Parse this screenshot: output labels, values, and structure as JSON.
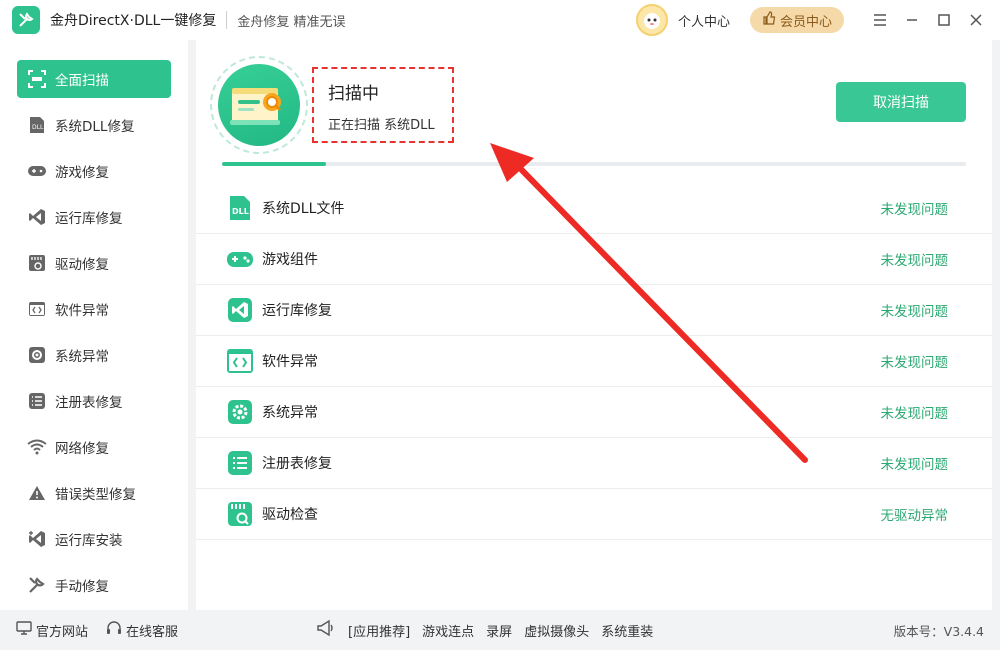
{
  "titlebar": {
    "app_title": "金舟DirectX·DLL一键修复",
    "slogan": "金舟修复 精准无误",
    "personal_center": "个人中心",
    "vip_center": "会员中心"
  },
  "sidebar": {
    "items": [
      {
        "label": "全面扫描",
        "icon": "full-scan-icon"
      },
      {
        "label": "系统DLL修复",
        "icon": "dll-icon"
      },
      {
        "label": "游戏修复",
        "icon": "gamepad-icon"
      },
      {
        "label": "运行库修复",
        "icon": "runtime-icon"
      },
      {
        "label": "驱动修复",
        "icon": "driver-icon"
      },
      {
        "label": "软件异常",
        "icon": "code-window-icon"
      },
      {
        "label": "系统异常",
        "icon": "gear-icon"
      },
      {
        "label": "注册表修复",
        "icon": "list-icon"
      },
      {
        "label": "网络修复",
        "icon": "wifi-icon"
      },
      {
        "label": "错误类型修复",
        "icon": "warning-icon"
      },
      {
        "label": "运行库安装",
        "icon": "install-icon"
      },
      {
        "label": "手动修复",
        "icon": "wrench-icon"
      }
    ]
  },
  "scan": {
    "title": "扫描中",
    "subtitle": "正在扫描 系统DLL",
    "cancel_label": "取消扫描",
    "progress_percent": 14
  },
  "results": [
    {
      "label": "系统DLL文件",
      "status": "未发现问题"
    },
    {
      "label": "游戏组件",
      "status": "未发现问题"
    },
    {
      "label": "运行库修复",
      "status": "未发现问题"
    },
    {
      "label": "软件异常",
      "status": "未发现问题"
    },
    {
      "label": "系统异常",
      "status": "未发现问题"
    },
    {
      "label": "注册表修复",
      "status": "未发现问题"
    },
    {
      "label": "驱动检查",
      "status": "无驱动异常"
    }
  ],
  "footer": {
    "official_site": "官方网站",
    "online_service": "在线客服",
    "app_recommend": "[应用推荐]",
    "links": [
      "游戏连点",
      "录屏",
      "虚拟摄像头",
      "系统重装"
    ],
    "version": "版本号：V3.4.4"
  },
  "colors": {
    "accent": "#2ec28f",
    "status_ok": "#2ca873",
    "annotation": "#e8322d"
  }
}
